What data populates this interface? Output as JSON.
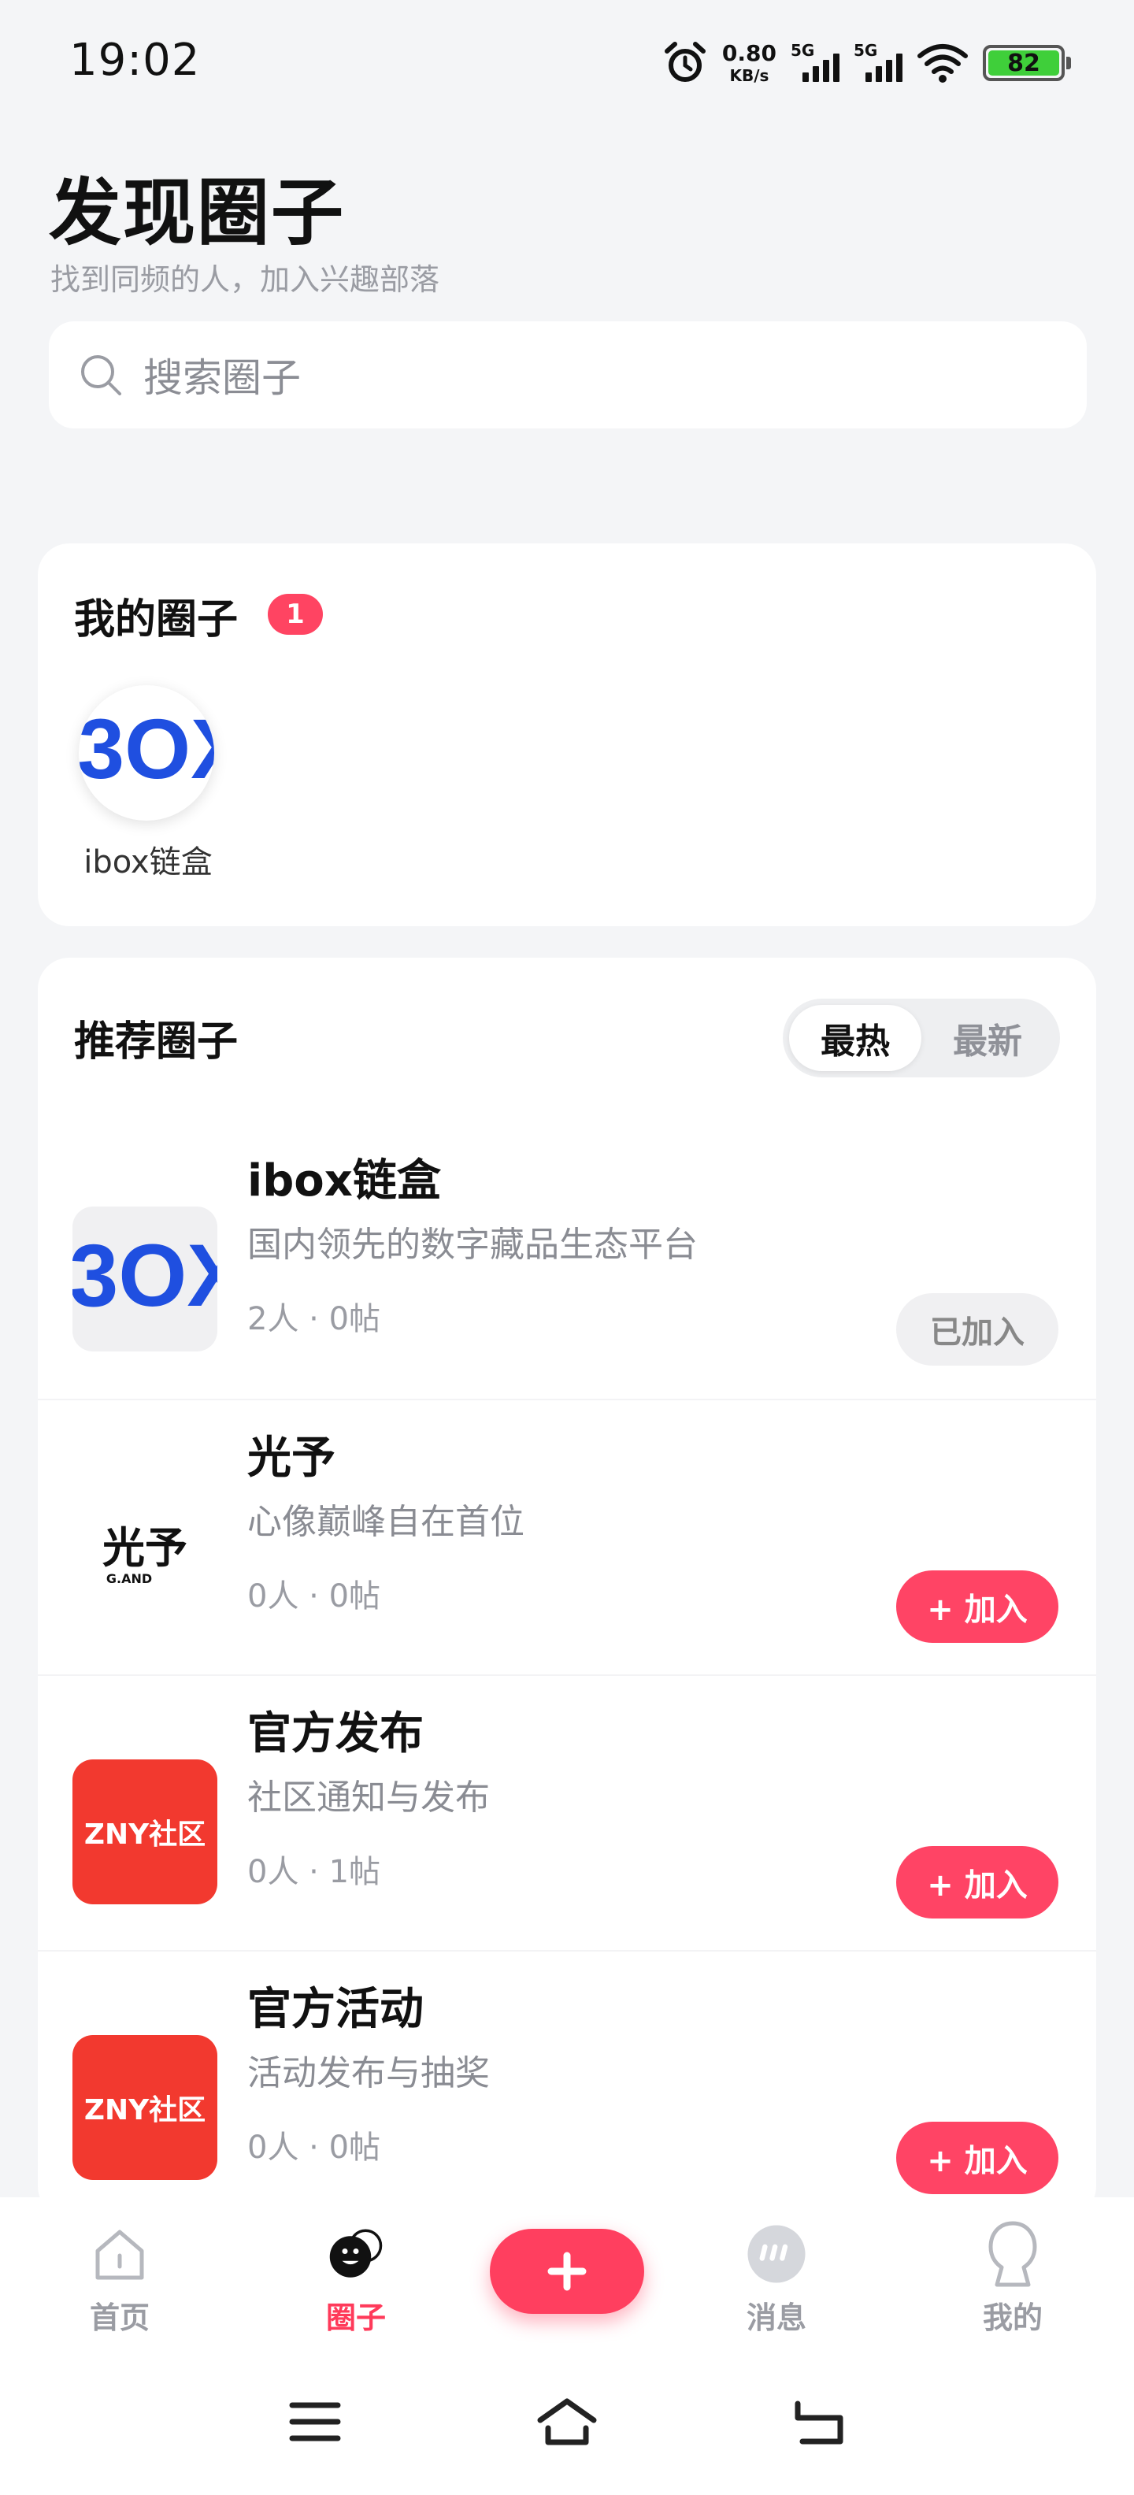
{
  "status": {
    "time": "19:02",
    "net_speed_value": "0.80",
    "net_speed_unit": "KB/s",
    "signal1": "5G",
    "signal2": "5G",
    "battery": "82",
    "battery_color": "#3fcf3a"
  },
  "header": {
    "title": "发现圈子",
    "subtitle": "找到同频的人，加入兴趣部落"
  },
  "search": {
    "placeholder": "搜索圈子"
  },
  "my_circles": {
    "title": "我的圈子",
    "count": "1",
    "items": [
      {
        "name": "ibox链盒",
        "logo": "ibox-logo"
      }
    ]
  },
  "recommended": {
    "title": "推荐圈子",
    "tabs": [
      "最热",
      "最新"
    ],
    "active_tab": "最热",
    "items": [
      {
        "name": "ibox链盒",
        "desc": "国内领先的数字藏品生态平台",
        "stats": "2人 · 0帖",
        "button": "已加入",
        "joined": true,
        "logo": "ibox-logo"
      },
      {
        "name": "光予",
        "desc": "心像巅峰自在首位",
        "stats": "0人 · 0帖",
        "button": "+ 加入",
        "joined": false,
        "logo": "guangyu-logo",
        "logo_text": "光予",
        "logo_subtext": "G.AND"
      },
      {
        "name": "官方发布",
        "desc": "社区通知与发布",
        "stats": "0人 · 1帖",
        "button": "+ 加入",
        "joined": false,
        "logo": "zny-logo",
        "logo_text": "ZNY社区"
      },
      {
        "name": "官方活动",
        "desc": "活动发布与抽奖",
        "stats": "0人 · 0帖",
        "button": "+ 加入",
        "joined": false,
        "logo": "zny-logo",
        "logo_text": "ZNY社区"
      }
    ]
  },
  "tab_bar": {
    "items": [
      {
        "label": "首页",
        "icon": "home-icon",
        "active": false
      },
      {
        "label": "圈子",
        "icon": "circle-icon",
        "active": true
      },
      {
        "label": "消息",
        "icon": "message-icon",
        "active": false
      },
      {
        "label": "我的",
        "icon": "profile-icon",
        "active": false
      }
    ],
    "fab_icon": "plus-icon"
  },
  "colors": {
    "accent": "#ff4465",
    "ibox_blue": "#1f4fe0",
    "zny_red": "#f2392f"
  }
}
